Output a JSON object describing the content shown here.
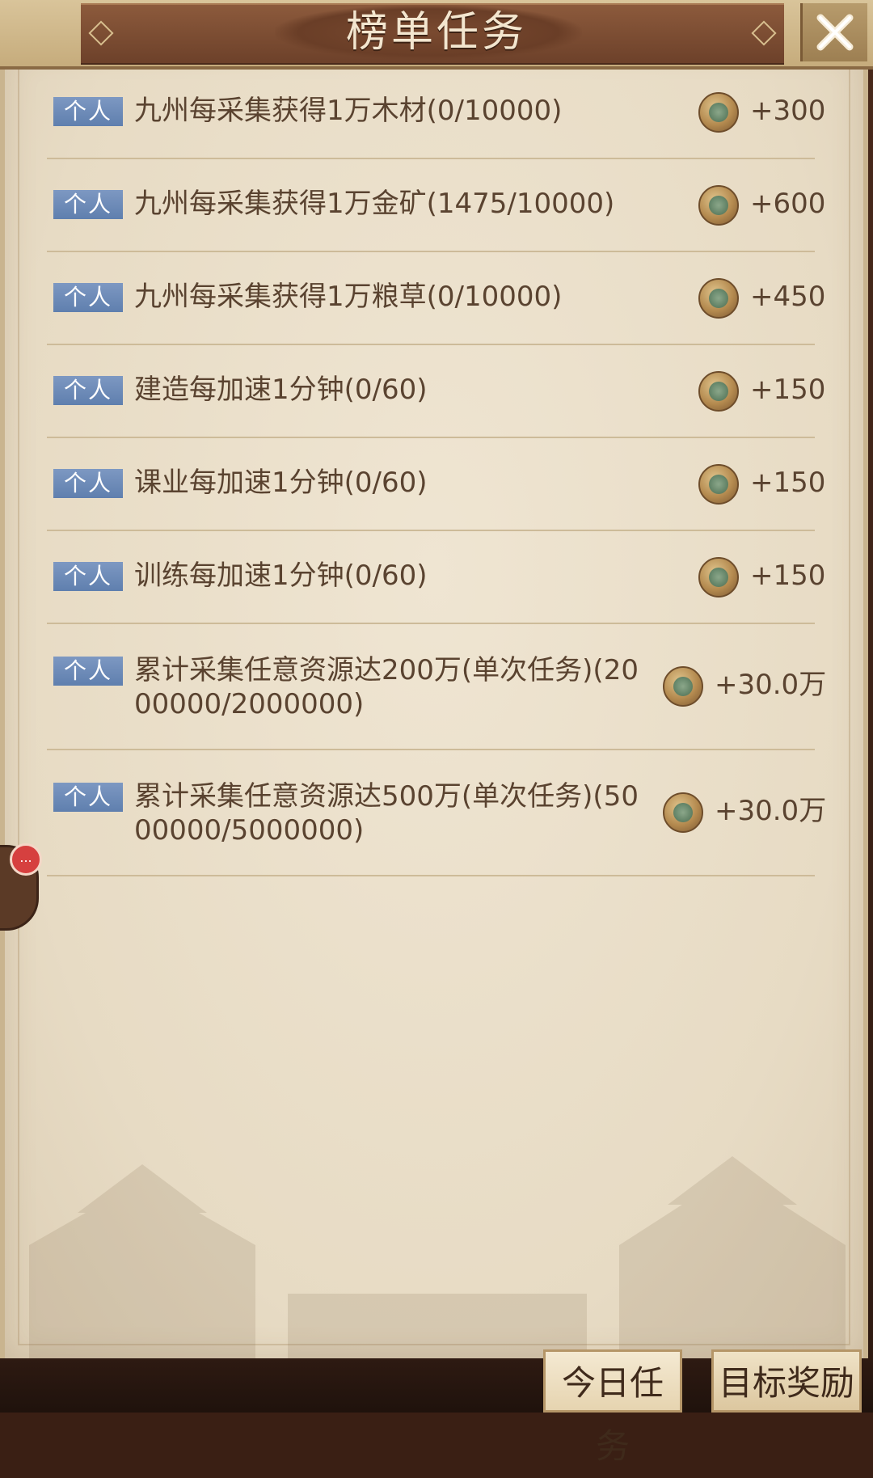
{
  "header": {
    "title": "榜单任务"
  },
  "tasks": [
    {
      "tag": "个人",
      "text": "九州每采集获得1万木材(0/10000)",
      "reward": "+300"
    },
    {
      "tag": "个人",
      "text": "九州每采集获得1万金矿(1475/10000)",
      "reward": "+600"
    },
    {
      "tag": "个人",
      "text": "九州每采集获得1万粮草(0/10000)",
      "reward": "+450"
    },
    {
      "tag": "个人",
      "text": "建造每加速1分钟(0/60)",
      "reward": "+150"
    },
    {
      "tag": "个人",
      "text": "课业每加速1分钟(0/60)",
      "reward": "+150"
    },
    {
      "tag": "个人",
      "text": "训练每加速1分钟(0/60)",
      "reward": "+150"
    },
    {
      "tag": "个人",
      "text": "累计采集任意资源达200万(单次任务)(2000000/2000000)",
      "reward": "+30.0万"
    },
    {
      "tag": "个人",
      "text": "累计采集任意资源达500万(单次任务)(5000000/5000000)",
      "reward": "+30.0万"
    }
  ],
  "side": {
    "badge_text": "..."
  },
  "tabs": [
    {
      "label": "今日任务",
      "active": true
    },
    {
      "label": "目标奖励",
      "active": false
    }
  ],
  "colors": {
    "tag_bg": "#6b88b8",
    "paper": "#eadfca",
    "title_ribbon": "#7a4a30",
    "text": "#5a4330"
  }
}
